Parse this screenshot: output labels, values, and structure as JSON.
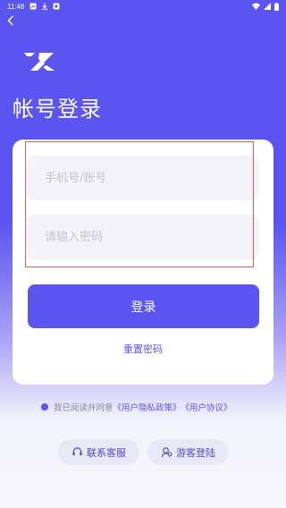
{
  "status_bar": {
    "time": "11:46",
    "icons_left": [
      "image-icon",
      "download-icon",
      "notification-icon"
    ],
    "icons_right": [
      "wifi-icon",
      "signal-icon",
      "battery-icon"
    ]
  },
  "header": {
    "back_icon": "chevron-left-icon",
    "title": "帐号登录"
  },
  "form": {
    "phone_placeholder": "手机号/账号",
    "phone_value": "",
    "password_placeholder": "请输入密码",
    "password_value": "",
    "login_label": "登录",
    "reset_label": "重置密码"
  },
  "agreement": {
    "prefix": "我已阅读并同意",
    "privacy_link": "《用户隐私政策》",
    "user_link": "《用户协议》"
  },
  "footer": {
    "service_label": "联系客服",
    "guest_label": "游客登陆"
  },
  "colors": {
    "brand": "#5b54f0",
    "highlight": "#e05a5a"
  }
}
